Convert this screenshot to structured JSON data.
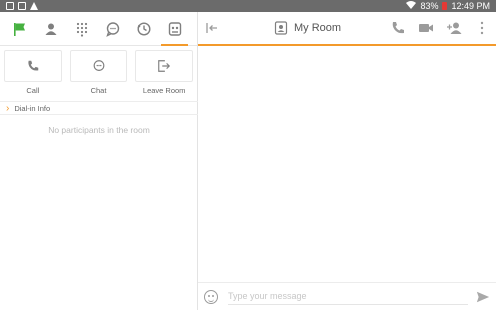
{
  "status_bar": {
    "battery": "83%",
    "time": "12:49 PM"
  },
  "tabs": [
    {
      "icon": "green-flag-icon",
      "active": false
    },
    {
      "icon": "contacts-icon",
      "active": false
    },
    {
      "icon": "dialpad-icon",
      "active": false
    },
    {
      "icon": "chat-icon",
      "active": false
    },
    {
      "icon": "history-icon",
      "active": false
    },
    {
      "icon": "room-icon",
      "active": true
    }
  ],
  "actions": [
    {
      "label": "Call",
      "icon": "phone-icon"
    },
    {
      "label": "Chat",
      "icon": "chat-icon"
    },
    {
      "label": "Leave Room",
      "icon": "leave-room-icon"
    }
  ],
  "dialin": {
    "label": "Dial-in Info"
  },
  "participants": {
    "empty_text": "No participants in the room"
  },
  "room": {
    "title": "My Room"
  },
  "composer": {
    "placeholder": "Type your message"
  },
  "colors": {
    "accent": "#f39a2b",
    "flag": "#46b140",
    "icon_gray": "#7f7f7f"
  }
}
